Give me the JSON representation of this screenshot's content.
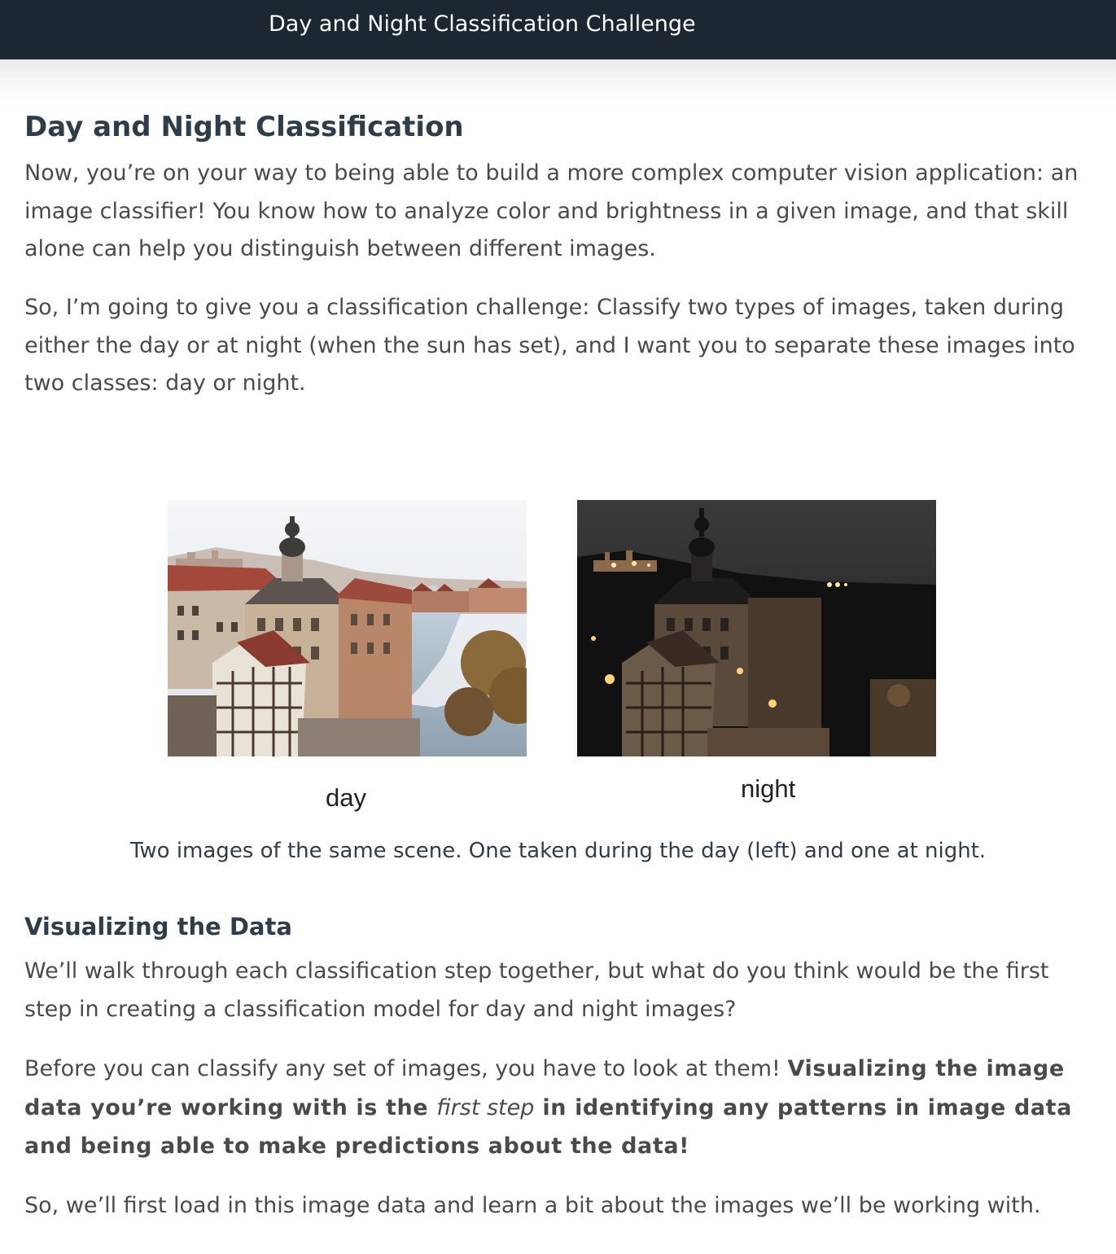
{
  "header": {
    "title": "Day and Night Classification Challenge"
  },
  "section1": {
    "heading": "Day and Night Classification",
    "paragraphs": [
      "Now, you’re on your way to being able to build a more complex computer vision application: an image classifier! You know how to analyze color and brightness in a given image, and that skill alone can help you distinguish between different images.",
      "So, I’m going to give you a classification challenge: Classify two types of images, taken during either the day or at night (when the sun has set), and I want you to separate these images into two classes: day or night."
    ]
  },
  "figure": {
    "day_label": "day",
    "night_label": "night",
    "caption": "Two images of the same scene. One taken during the day (left) and one at night."
  },
  "section2": {
    "heading": "Visualizing the Data",
    "paragraph1": "We’ll walk through each classification step together, but what do you think would be the first step in creating a classification model for day and night images?",
    "paragraph2": {
      "lead": "Before you can classify any set of images, you have to look at them! ",
      "bold_start": "Visualizing the image data you’re working with is the ",
      "italic": "first step",
      "bold_end": " in identifying any patterns in image data and being able to make predictions about the data!"
    },
    "paragraph3": "So, we’ll first load in this image data and learn a bit about the images we’ll be working with."
  }
}
